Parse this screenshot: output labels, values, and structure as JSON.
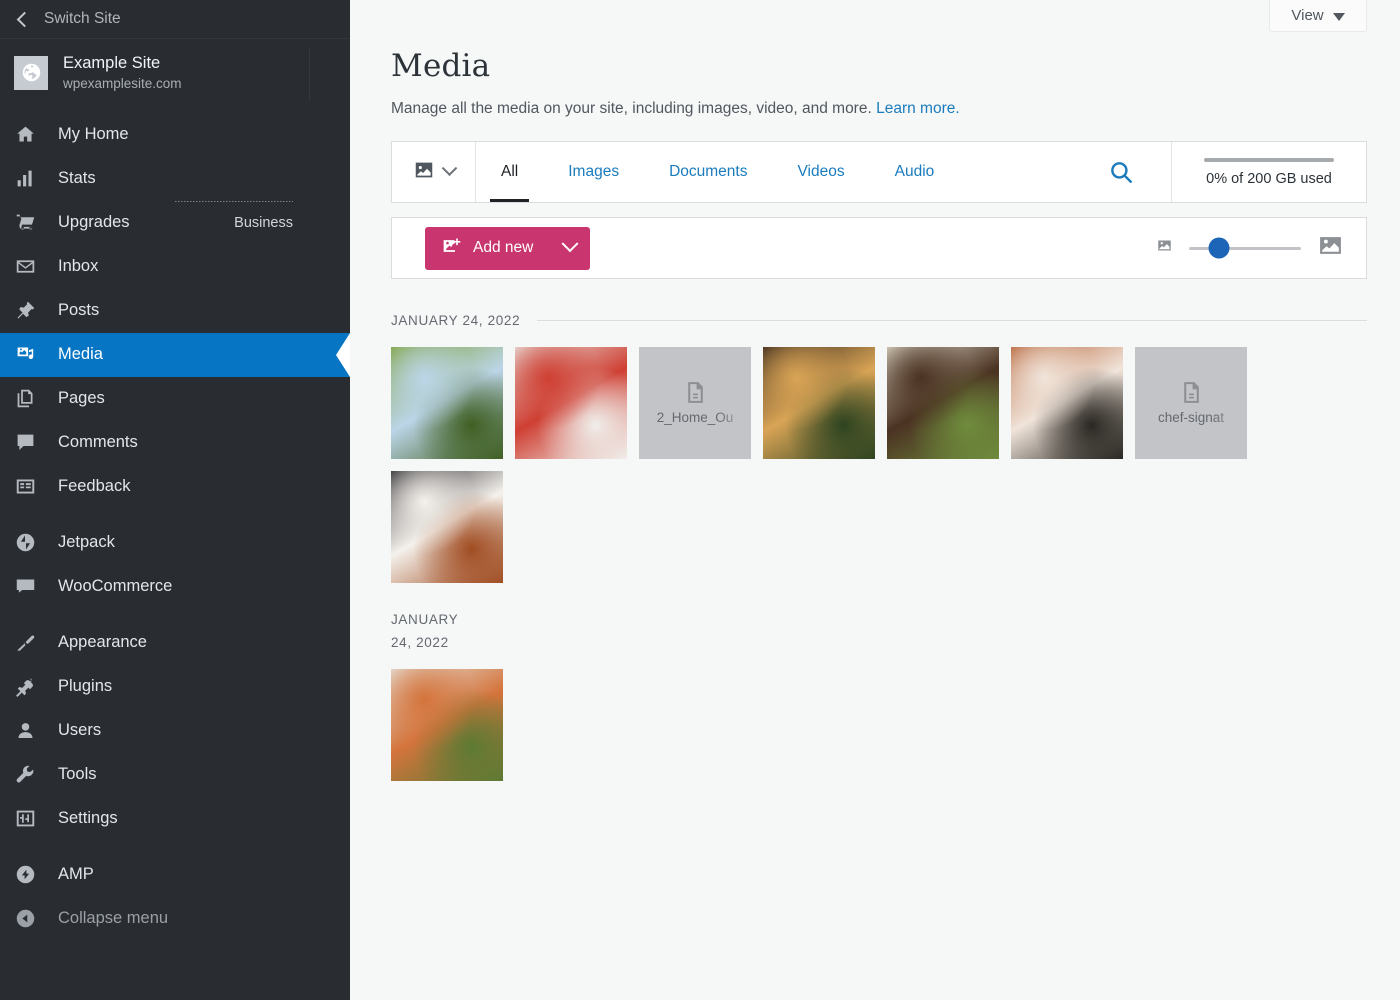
{
  "sidebar": {
    "switch_site": {
      "label": "Switch Site",
      "icon": "chevron-left-icon"
    },
    "site": {
      "name": "Example Site",
      "url": "wpexamplesite.com",
      "icon": "globe-icon"
    },
    "groups": [
      {
        "items": [
          {
            "label": "My Home",
            "icon": "home-icon",
            "active": false
          },
          {
            "label": "Stats",
            "icon": "bar-chart-icon",
            "active": false
          },
          {
            "label": "Upgrades",
            "icon": "cart-icon",
            "badge": "Business",
            "active": false
          },
          {
            "label": "Inbox",
            "icon": "envelope-icon",
            "active": false
          },
          {
            "label": "Posts",
            "icon": "pin-icon",
            "active": false
          },
          {
            "label": "Media",
            "icon": "media-icon",
            "active": true
          },
          {
            "label": "Pages",
            "icon": "pages-icon",
            "active": false
          },
          {
            "label": "Comments",
            "icon": "comment-icon",
            "active": false
          },
          {
            "label": "Feedback",
            "icon": "feedback-icon",
            "active": false
          }
        ]
      },
      {
        "items": [
          {
            "label": "Jetpack",
            "icon": "jetpack-icon",
            "active": false
          },
          {
            "label": "WooCommerce",
            "icon": "woo-icon",
            "active": false
          }
        ]
      },
      {
        "items": [
          {
            "label": "Appearance",
            "icon": "paintbrush-icon",
            "active": false
          },
          {
            "label": "Plugins",
            "icon": "plug-icon",
            "active": false
          },
          {
            "label": "Users",
            "icon": "user-icon",
            "active": false
          },
          {
            "label": "Tools",
            "icon": "wrench-icon",
            "active": false
          },
          {
            "label": "Settings",
            "icon": "sliders-icon",
            "active": false
          }
        ]
      },
      {
        "items": [
          {
            "label": "AMP",
            "icon": "amp-icon",
            "active": false
          },
          {
            "label": "Collapse menu",
            "icon": "collapse-icon",
            "active": false,
            "muted": true
          }
        ]
      }
    ]
  },
  "header": {
    "view_button": {
      "label": "View",
      "icon": "caret-down-icon"
    },
    "title": "Media",
    "subtitle": "Manage all the media on your site, including images, video, and more.",
    "learn_more": "Learn more."
  },
  "filter_bar": {
    "type_select": {
      "icon": "image-icon",
      "caret": "chevron-down-icon"
    },
    "tabs": [
      {
        "label": "All",
        "active": true
      },
      {
        "label": "Images",
        "active": false
      },
      {
        "label": "Documents",
        "active": false
      },
      {
        "label": "Videos",
        "active": false
      },
      {
        "label": "Audio",
        "active": false
      }
    ],
    "search": {
      "icon": "search-icon"
    },
    "storage": {
      "text": "0% of 200 GB used",
      "percent": 0
    }
  },
  "action_bar": {
    "add_new": {
      "label": "Add new",
      "icon": "add-image-icon",
      "caret": "chevron-down-icon",
      "color": "#c9356e"
    },
    "size_slider": {
      "min_icon": "small-image-icon",
      "max_icon": "large-image-icon",
      "value_percent": 27
    }
  },
  "media_groups": [
    {
      "date": "JANUARY 24, 2022",
      "has_rule": true,
      "items": [
        {
          "type": "image",
          "name": "garden-greenhouse",
          "c1": "#7fa33d",
          "c2": "#bcd5e8",
          "c3": "#3f5f22"
        },
        {
          "type": "image",
          "name": "caprese-salad-plate",
          "c1": "#e8e4df",
          "c2": "#cf3f33",
          "c3": "#f0eeea"
        },
        {
          "type": "document",
          "name": "2_Home_Ou"
        },
        {
          "type": "image",
          "name": "plated-dish-greens",
          "c1": "#3a2b1f",
          "c2": "#d9a455",
          "c3": "#2e4420"
        },
        {
          "type": "image",
          "name": "steak-with-herbs",
          "c1": "#ded7c6",
          "c2": "#4b3222",
          "c3": "#6f8c3c"
        },
        {
          "type": "image",
          "name": "chef-at-work",
          "c1": "#b8663a",
          "c2": "#f0e4da",
          "c3": "#2a2722"
        },
        {
          "type": "document",
          "name": "chef-signat"
        },
        {
          "type": "image",
          "name": "table-of-dishes",
          "c1": "#2d2b2e",
          "c2": "#f4f1ec",
          "c3": "#a14d22"
        }
      ]
    },
    {
      "date": "JANUARY 24, 2022",
      "has_rule": false,
      "items": [
        {
          "type": "image",
          "name": "salmon-with-salsa",
          "c1": "#e6e3db",
          "c2": "#d4743c",
          "c3": "#5c7a33"
        }
      ]
    }
  ]
}
